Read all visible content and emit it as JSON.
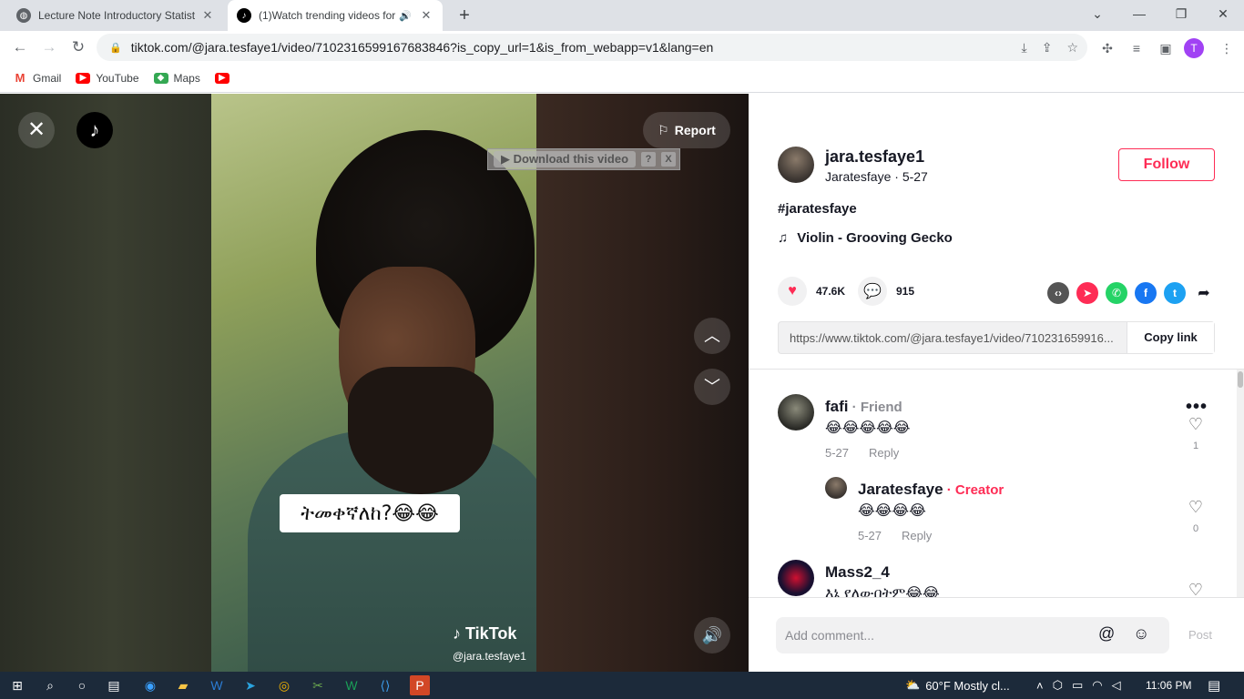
{
  "browser": {
    "tabs": [
      {
        "title": "Lecture Note Introductory Statist",
        "active": false
      },
      {
        "title": "(1)Watch trending videos for",
        "active": true
      }
    ],
    "url": "tiktok.com/@jara.tesfaye1/video/7102316599167683846?is_copy_url=1&is_from_webapp=v1&lang=en",
    "profile_initial": "T",
    "bookmarks": [
      {
        "label": "Gmail"
      },
      {
        "label": "YouTube"
      },
      {
        "label": "Maps"
      },
      {
        "label": ""
      }
    ]
  },
  "video": {
    "report_label": "Report",
    "download_label": "Download this video",
    "download_help": "?",
    "download_close": "X",
    "caption": "ትመቀኛለከ?😂😂",
    "watermark": "TikTok",
    "watermark_handle": "@jara.tesfaye1"
  },
  "author": {
    "username": "jara.tesfaye1",
    "subtitle": "Jaratesfaye · 5-27",
    "follow_label": "Follow"
  },
  "post": {
    "hashtag": "#jaratesfaye",
    "music": "Violin - Grooving Gecko",
    "likes": "47.6K",
    "comments": "915",
    "link": "https://www.tiktok.com/@jara.tesfaye1/video/710231659916...",
    "copy_label": "Copy link"
  },
  "comments": [
    {
      "name": "fafi",
      "tag": "Friend",
      "text": "😂😂😂😂😂",
      "date": "5-27",
      "reply": "Reply",
      "likes": "1"
    },
    {
      "name": "Jaratesfaye",
      "tag": "Creator",
      "text": "😂😂😂😂",
      "date": "5-27",
      "reply": "Reply",
      "likes": "0"
    },
    {
      "name": "Mass2_4",
      "tag": "",
      "text": "እኔ የለውበትም😂😂",
      "date": "",
      "reply": "",
      "likes": ""
    }
  ],
  "comment_box": {
    "placeholder": "Add comment...",
    "post_label": "Post"
  },
  "taskbar": {
    "weather": "60°F  Mostly cl...",
    "time": "11:06 PM"
  },
  "colors": {
    "accent": "#fe2c55",
    "taskbar": "#1c2a3a"
  }
}
